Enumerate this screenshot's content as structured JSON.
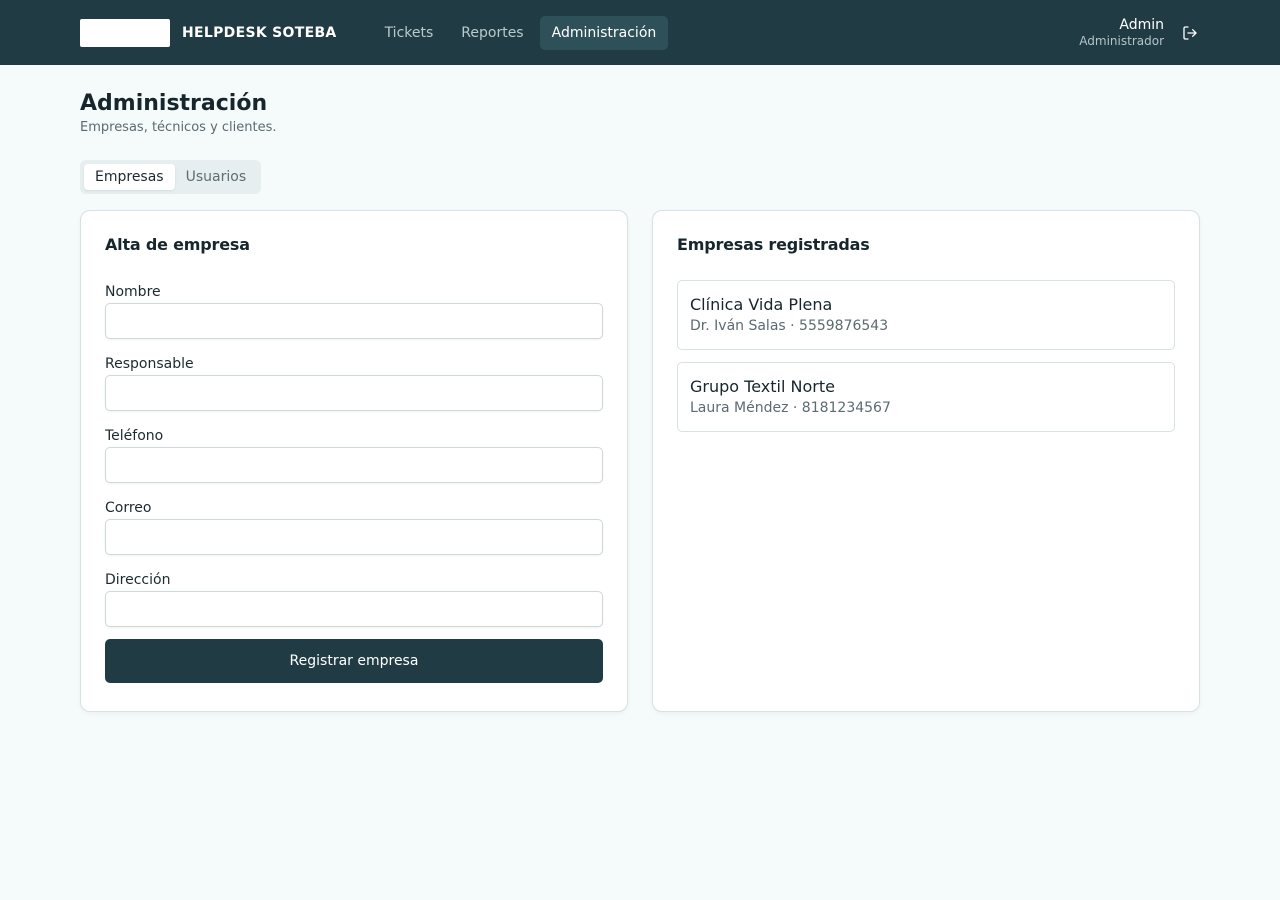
{
  "header": {
    "brand": "HELPDESK SOTEBA",
    "nav": [
      {
        "label": "Tickets"
      },
      {
        "label": "Reportes"
      },
      {
        "label": "Administración"
      }
    ],
    "user": {
      "name": "Admin",
      "role": "Administrador"
    },
    "logout_icon": "logout-icon"
  },
  "page": {
    "title": "Administración",
    "subtitle": "Empresas, técnicos y clientes."
  },
  "tabs": [
    {
      "label": "Empresas",
      "active": true
    },
    {
      "label": "Usuarios",
      "active": false
    }
  ],
  "form": {
    "title": "Alta de empresa",
    "fields": [
      {
        "label": "Nombre",
        "value": ""
      },
      {
        "label": "Responsable",
        "value": ""
      },
      {
        "label": "Teléfono",
        "value": ""
      },
      {
        "label": "Correo",
        "value": ""
      },
      {
        "label": "Dirección",
        "value": ""
      }
    ],
    "submit_label": "Registrar empresa"
  },
  "companies": {
    "title": "Empresas registradas",
    "items": [
      {
        "name": "Clínica Vida Plena",
        "meta": "Dr. Iván Salas · 5559876543"
      },
      {
        "name": "Grupo Textil Norte",
        "meta": "Laura Méndez · 8181234567"
      }
    ]
  },
  "colors": {
    "header_bg": "#203b43",
    "nav_active_bg": "#2e5059",
    "page_bg": "#f5fafa",
    "button_bg": "#203b43"
  }
}
